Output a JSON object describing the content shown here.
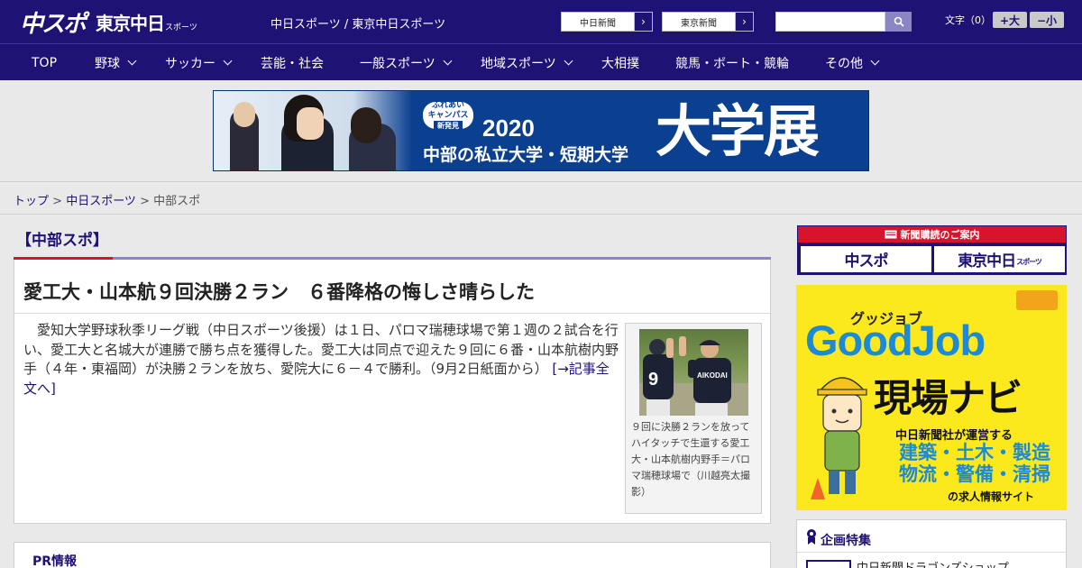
{
  "header": {
    "logo_main": "中スポ",
    "logo_sub": "東京中日",
    "logo_sub_small": "スポーツ",
    "site_links": "中日スポーツ / 東京中日スポーツ",
    "site_buttons": [
      "中日新聞",
      "東京新聞"
    ],
    "search_placeholder": "",
    "font_label": "文字（0）",
    "font_bigger": "+大",
    "font_smaller": "−小"
  },
  "nav": [
    {
      "label": "TOP",
      "dropdown": false
    },
    {
      "label": "野球",
      "dropdown": true
    },
    {
      "label": "サッカー",
      "dropdown": true
    },
    {
      "label": "芸能・社会",
      "dropdown": false
    },
    {
      "label": "一般スポーツ",
      "dropdown": true
    },
    {
      "label": "地域スポーツ",
      "dropdown": true
    },
    {
      "label": "大相撲",
      "dropdown": false
    },
    {
      "label": "競馬・ボート・競輪",
      "dropdown": false
    },
    {
      "label": "その他",
      "dropdown": true
    }
  ],
  "banner": {
    "badge_top": "ふれあい",
    "badge_mid": "キャンパス",
    "badge_sub": "新発見",
    "year": "2020",
    "desc": "中部の私立大学・短期大学",
    "big": "大学展"
  },
  "breadcrumb": [
    "トップ",
    "中日スポーツ",
    "中部スポ"
  ],
  "section_title": "【中部スポ】",
  "article": {
    "headline": "愛工大・山本航９回決勝２ラン　６番降格の悔しさ晴らした",
    "body": "愛知大学野球秋季リーグ戦（中日スポーツ後援）は１日、パロマ瑞穂球場で第１週の２試合を行い、愛工大と名城大が連勝で勝ち点を獲得した。愛工大は同点で迎えた９回に６番・山本航樹内野手（４年・東福岡）が決勝２ランを放ち、愛院大に６－４で勝利。（9月2日紙面から）",
    "more_link": "[→記事全文へ]",
    "caption": "９回に決勝２ランを放ってハイタッチで生還する愛工大・山本航樹内野手＝パロマ瑞穂球場で（川越亮太撮影）",
    "photo_jersey_text": "AIKODAI",
    "photo_number": "9"
  },
  "pr_title": "PR情報",
  "sidebar": {
    "subscribe_header": "新聞購読のご案内",
    "subscribe_left": "中スポ",
    "subscribe_right": "東京中日",
    "subscribe_right_small": "スポーツ",
    "goodjob": {
      "kata": "グッジョブ",
      "title": "GoodJob",
      "nav": "現場ナビ",
      "line1": "中日新聞社が運営する",
      "line2": "建築・土木・製造",
      "line3": "物流・警備・清掃",
      "line4": "の求人情報サイト"
    },
    "feature_title": "企画特集",
    "feature_item": "中日新聞ドラゴンズショップ"
  },
  "colors": {
    "brand": "#1e1275",
    "accent_red": "#d8142d",
    "accent_purple": "#8a86c6",
    "goodjob_yellow": "#fbe91d",
    "goodjob_blue": "#1d8ad6"
  }
}
